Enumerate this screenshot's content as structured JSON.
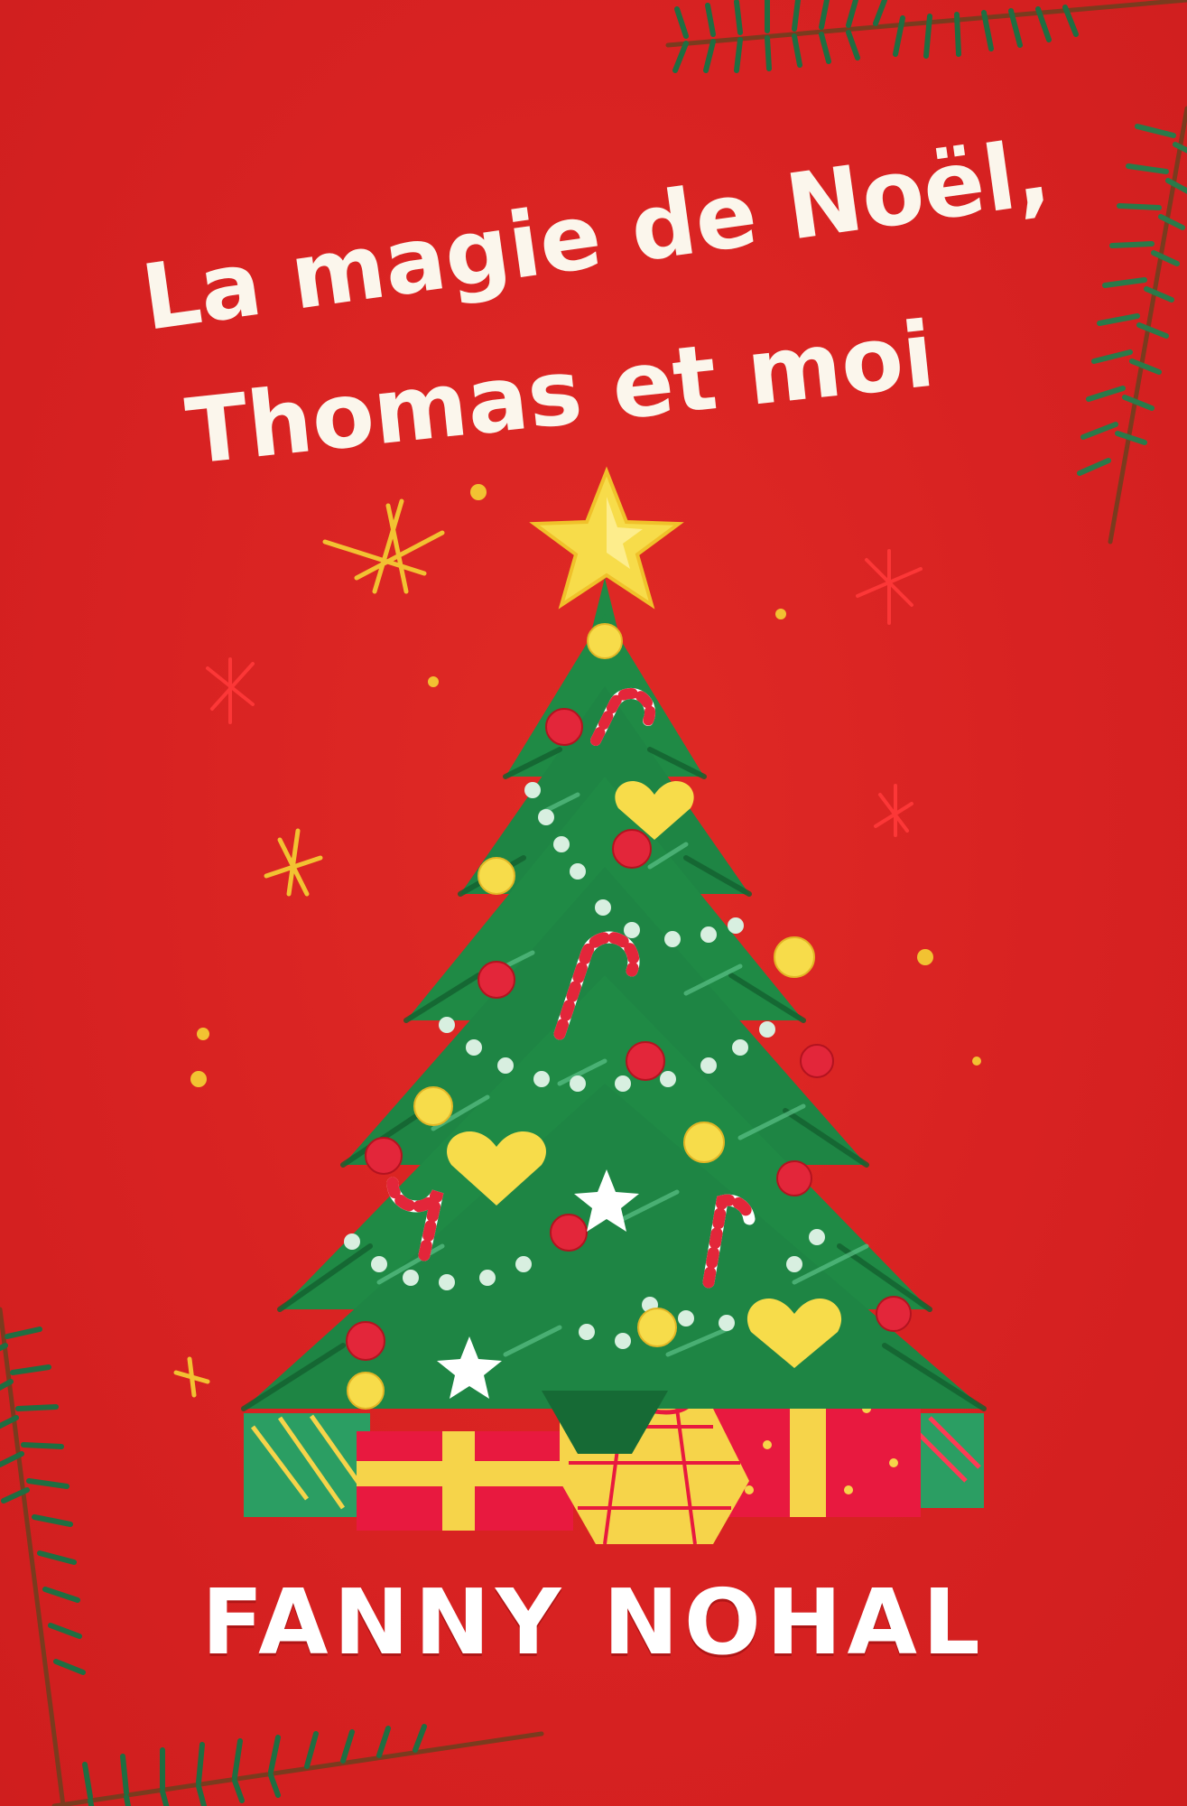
{
  "cover": {
    "title_line1": "La magie de Noël,",
    "title_line2": "Thomas et moi",
    "author": "FANNY NOHAL"
  },
  "colors": {
    "background": "#d92222",
    "tree_green": "#1f8a45",
    "tree_dark": "#13602f",
    "star_yellow": "#f7dc4a",
    "ornament_red": "#e3263a",
    "text_cream": "#fbf6ec"
  },
  "icons": [
    "christmas-tree-icon",
    "star-icon",
    "candy-cane-icon",
    "gift-box-icon",
    "sparkle-icon",
    "pine-branch-icon"
  ]
}
